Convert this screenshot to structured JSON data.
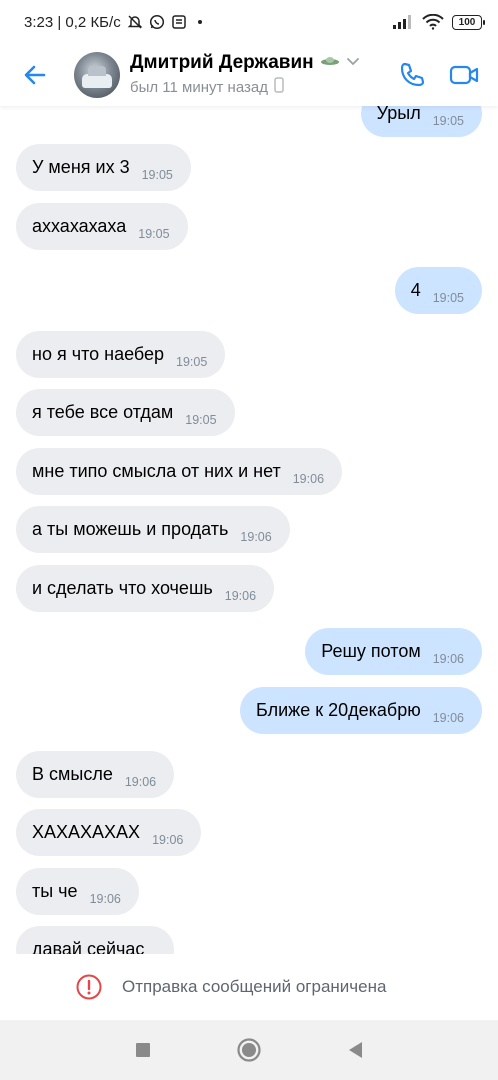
{
  "status_bar": {
    "time_text": "3:23 | 0,2 КБ/с",
    "battery": "100"
  },
  "header": {
    "contact_name": "Дмитрий Державин",
    "last_seen": "был 11 минут назад"
  },
  "messages": [
    {
      "dir": "out",
      "text": "Урыл",
      "time": "19:05"
    },
    {
      "dir": "in",
      "text": "У меня их 3",
      "time": "19:05"
    },
    {
      "dir": "in",
      "text": "аххахахаха",
      "time": "19:05"
    },
    {
      "dir": "out",
      "text": "4",
      "time": "19:05"
    },
    {
      "dir": "in",
      "text": "но я что наебер",
      "time": "19:05"
    },
    {
      "dir": "in",
      "text": "я тебе все отдам",
      "time": "19:05"
    },
    {
      "dir": "in",
      "text": "мне типо смысла от них и нет",
      "time": "19:06"
    },
    {
      "dir": "in",
      "text": "а ты можешь и продать",
      "time": "19:06"
    },
    {
      "dir": "in",
      "text": "и сделать что хочешь",
      "time": "19:06"
    },
    {
      "dir": "out",
      "text": "Решу потом",
      "time": "19:06"
    },
    {
      "dir": "out",
      "text": "Ближе к 20декабрю",
      "time": "19:06"
    },
    {
      "dir": "in",
      "text": "В смысле",
      "time": "19:06"
    },
    {
      "dir": "in",
      "text": "ХАХАХАХАХ",
      "time": "19:06"
    },
    {
      "dir": "in",
      "text": "ты че",
      "time": "19:06"
    },
    {
      "dir": "in",
      "text": "давай сейчас",
      "time": ""
    }
  ],
  "restriction": {
    "text": "Отправка сообщений ограничена"
  },
  "colors": {
    "accent": "#2688eb",
    "incoming_bubble": "#ebedf0",
    "outgoing_bubble": "#cce4ff",
    "warning": "#e64646"
  }
}
